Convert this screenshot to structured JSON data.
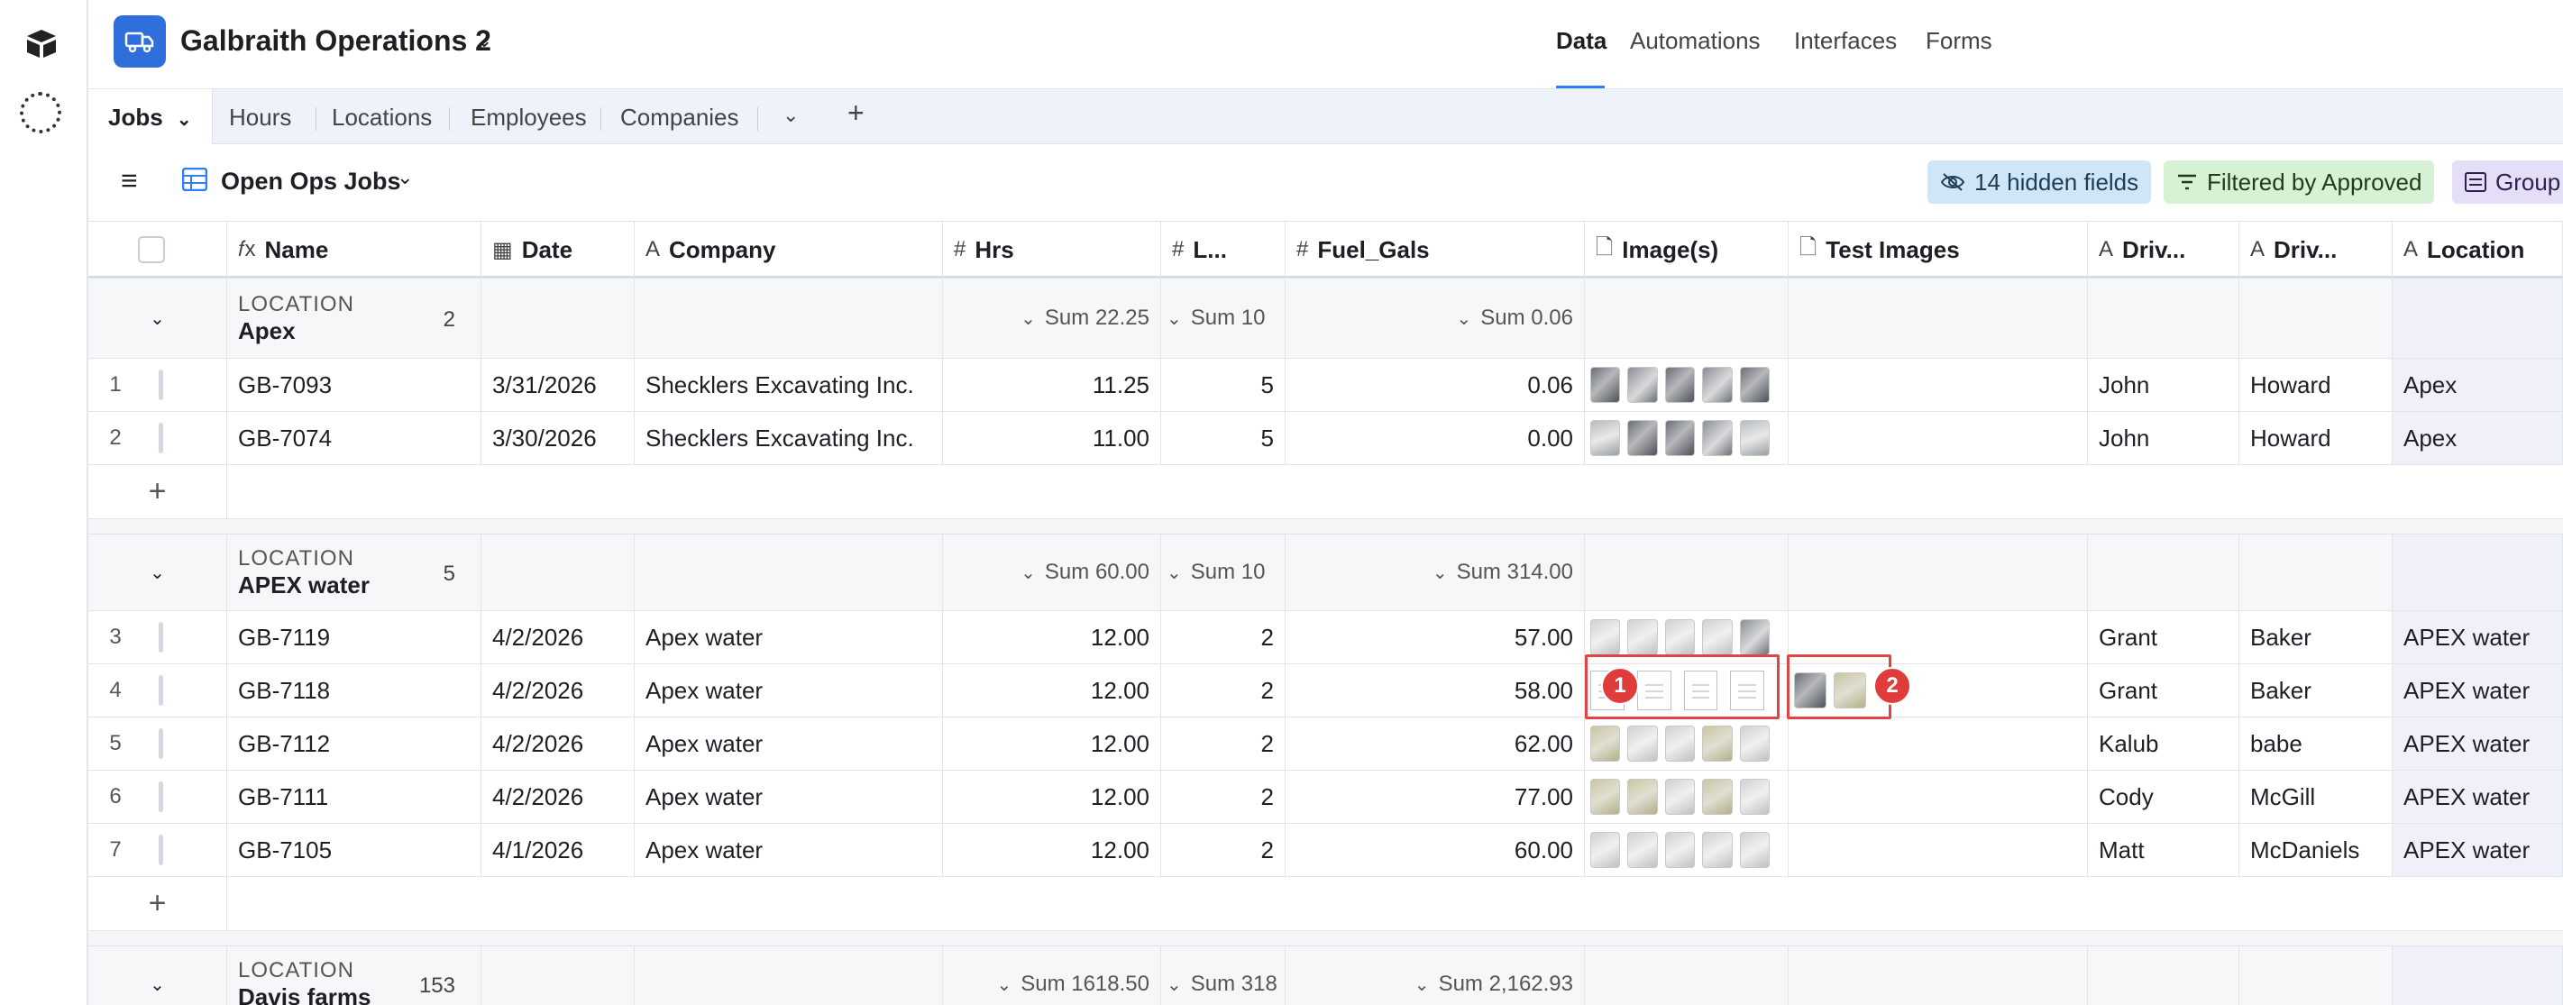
{
  "app": {
    "title": "Galbraith Operations 2"
  },
  "nav": {
    "items": [
      "Data",
      "Automations",
      "Interfaces",
      "Forms"
    ],
    "active": "Data"
  },
  "tabs": {
    "items": [
      "Jobs",
      "Hours",
      "Locations",
      "Employees",
      "Companies"
    ],
    "active": "Jobs"
  },
  "view": {
    "name": "Open Ops Jobs",
    "hidden_fields": "14 hidden fields",
    "filter": "Filtered by Approved",
    "group": "Group"
  },
  "columns": {
    "name": "Name",
    "date": "Date",
    "company": "Company",
    "hrs": "Hrs",
    "l": "L...",
    "fuel": "Fuel_Gals",
    "images": "Image(s)",
    "test_images": "Test Images",
    "driver1": "Driv...",
    "driver2": "Driv...",
    "location": "Location"
  },
  "groups": [
    {
      "label": "LOCATION",
      "value": "Apex",
      "count": "2",
      "sum_hrs": "Sum 22.25",
      "sum_l": "Sum 10",
      "sum_fuel": "Sum 0.06"
    },
    {
      "label": "LOCATION",
      "value": "APEX water",
      "count": "5",
      "sum_hrs": "Sum 60.00",
      "sum_l": "Sum 10",
      "sum_fuel": "Sum 314.00"
    },
    {
      "label": "LOCATION",
      "value": "Davis farms",
      "count": "153",
      "sum_hrs": "Sum 1618.50",
      "sum_l": "Sum 318",
      "sum_fuel": "Sum 2,162.93"
    }
  ],
  "rows": [
    {
      "num": "1",
      "name": "GB-7093",
      "date": "3/31/2026",
      "company": "Shecklers Excavating Inc.",
      "hrs": "11.25",
      "l": "5",
      "fuel": "0.06",
      "d1": "John",
      "d2": "Howard",
      "loc": "Apex"
    },
    {
      "num": "2",
      "name": "GB-7074",
      "date": "3/30/2026",
      "company": "Shecklers Excavating Inc.",
      "hrs": "11.00",
      "l": "5",
      "fuel": "0.00",
      "d1": "John",
      "d2": "Howard",
      "loc": "Apex"
    },
    {
      "num": "3",
      "name": "GB-7119",
      "date": "4/2/2026",
      "company": "Apex water",
      "hrs": "12.00",
      "l": "2",
      "fuel": "57.00",
      "d1": "Grant",
      "d2": "Baker",
      "loc": "APEX water"
    },
    {
      "num": "4",
      "name": "GB-7118",
      "date": "4/2/2026",
      "company": "Apex water",
      "hrs": "12.00",
      "l": "2",
      "fuel": "58.00",
      "d1": "Grant",
      "d2": "Baker",
      "loc": "APEX water"
    },
    {
      "num": "5",
      "name": "GB-7112",
      "date": "4/2/2026",
      "company": "Apex water",
      "hrs": "12.00",
      "l": "2",
      "fuel": "62.00",
      "d1": "Kalub",
      "d2": "babe",
      "loc": "APEX water"
    },
    {
      "num": "6",
      "name": "GB-7111",
      "date": "4/2/2026",
      "company": "Apex water",
      "hrs": "12.00",
      "l": "2",
      "fuel": "77.00",
      "d1": "Cody",
      "d2": "McGill",
      "loc": "APEX water"
    },
    {
      "num": "7",
      "name": "GB-7105",
      "date": "4/1/2026",
      "company": "Apex water",
      "hrs": "12.00",
      "l": "2",
      "fuel": "60.00",
      "d1": "Matt",
      "d2": "McDaniels",
      "loc": "APEX water"
    }
  ],
  "annotations": {
    "badge1": "1",
    "badge2": "2"
  }
}
